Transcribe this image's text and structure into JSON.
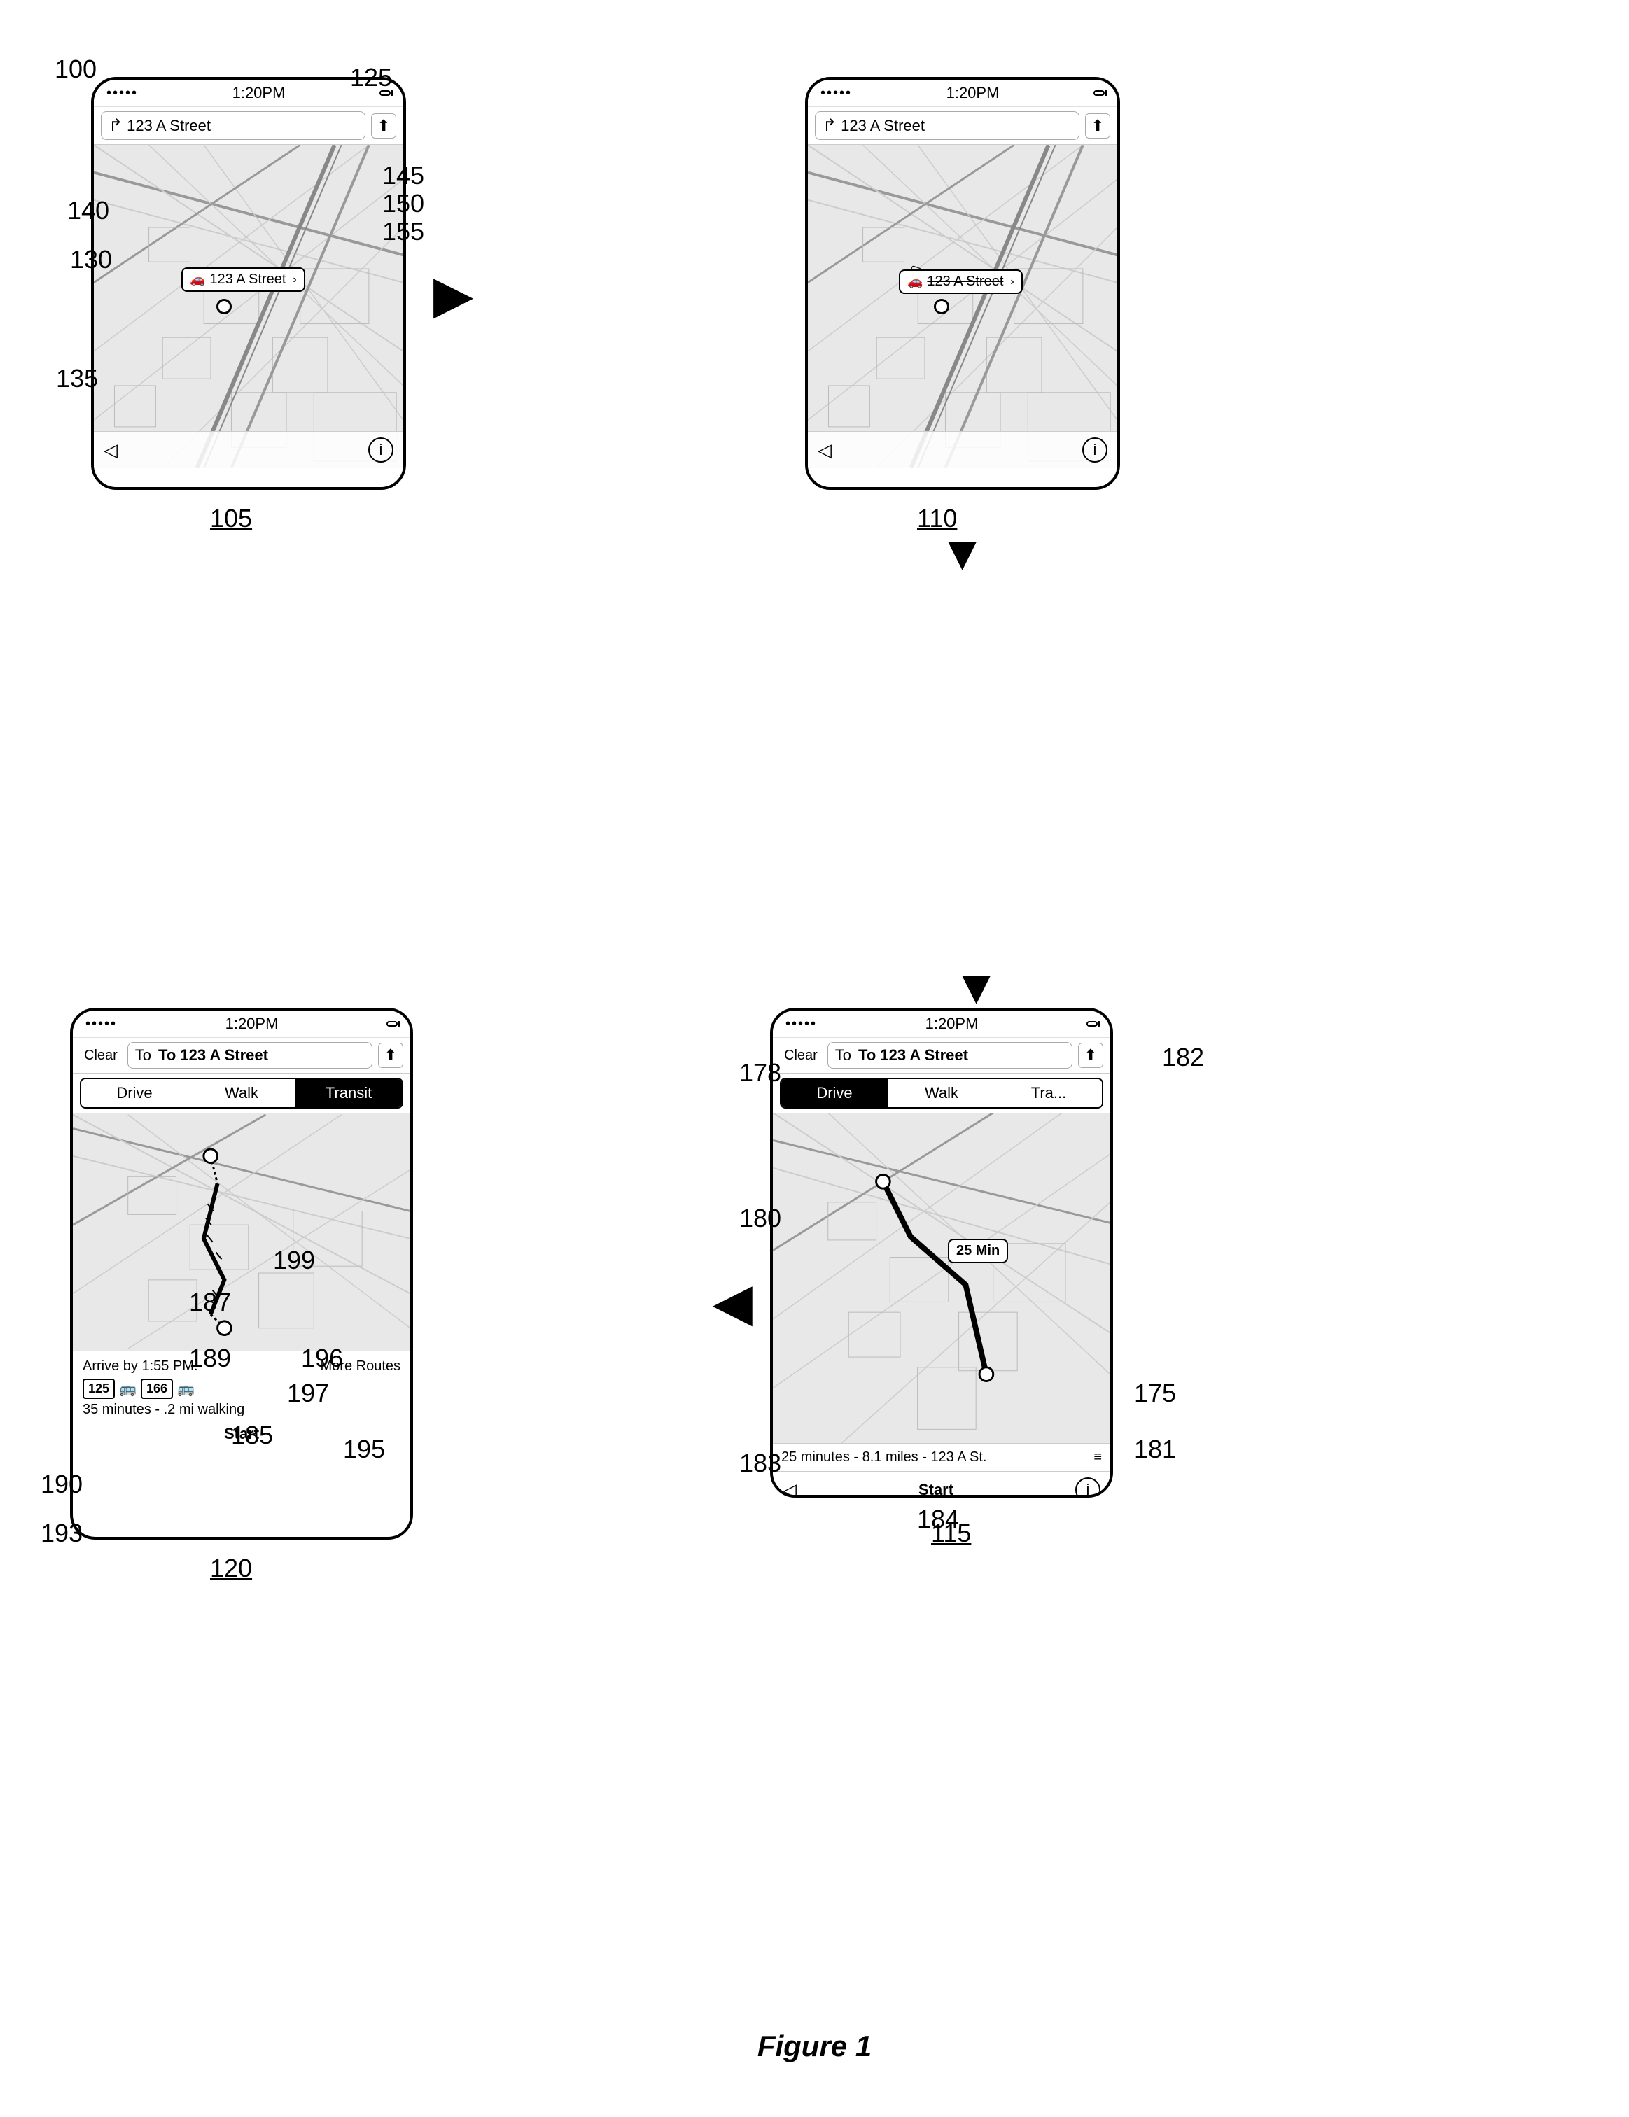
{
  "figure": {
    "caption": "Figure 1"
  },
  "labels": {
    "main": "100",
    "fig105": "105",
    "fig110": "110",
    "fig115": "115",
    "fig120": "120",
    "l125": "125",
    "l130": "130",
    "l135": "135",
    "l140": "140",
    "l145": "145",
    "l150": "150",
    "l155": "155",
    "l175": "175",
    "l178": "178",
    "l180": "180",
    "l181": "181",
    "l182": "182",
    "l183": "183",
    "l184": "184",
    "l185": "185",
    "l187": "187",
    "l189": "189",
    "l190": "190",
    "l193": "193",
    "l195": "195",
    "l196": "196",
    "l197": "197",
    "l199": "199"
  },
  "screen105": {
    "status": {
      "dots": "•••••",
      "time": "1:20PM",
      "battery": "▮"
    },
    "search": {
      "address": "123 A Street"
    },
    "callout": "123 A Street"
  },
  "screen110": {
    "status": {
      "dots": "•••••",
      "time": "1:20PM",
      "battery": "▮"
    },
    "search": {
      "address": "123 A Street"
    },
    "callout": "123 A Street"
  },
  "screen115": {
    "status": {
      "dots": "•••••",
      "time": "1:20PM",
      "battery": "▮"
    },
    "clear": "Clear",
    "destination": "To 123 A Street",
    "segments": [
      "Drive",
      "Walk",
      "Tra..."
    ],
    "active_segment": 0,
    "route_info": "25 minutes - 8.1 miles - 123 A St.",
    "start": "Start",
    "time_callout": "25 Min"
  },
  "screen120": {
    "status": {
      "dots": "•••••",
      "time": "1:20PM",
      "battery": "▮"
    },
    "clear": "Clear",
    "destination": "To 123 A Street",
    "segments": [
      "Drive",
      "Walk",
      "Transit"
    ],
    "active_segment": 2,
    "arrive": "Arrive by 1:55 PM.",
    "more_routes": "More Routes",
    "badge1": "125",
    "badge2": "166",
    "route_detail": "35 minutes - .2 mi walking",
    "start": "Start"
  }
}
